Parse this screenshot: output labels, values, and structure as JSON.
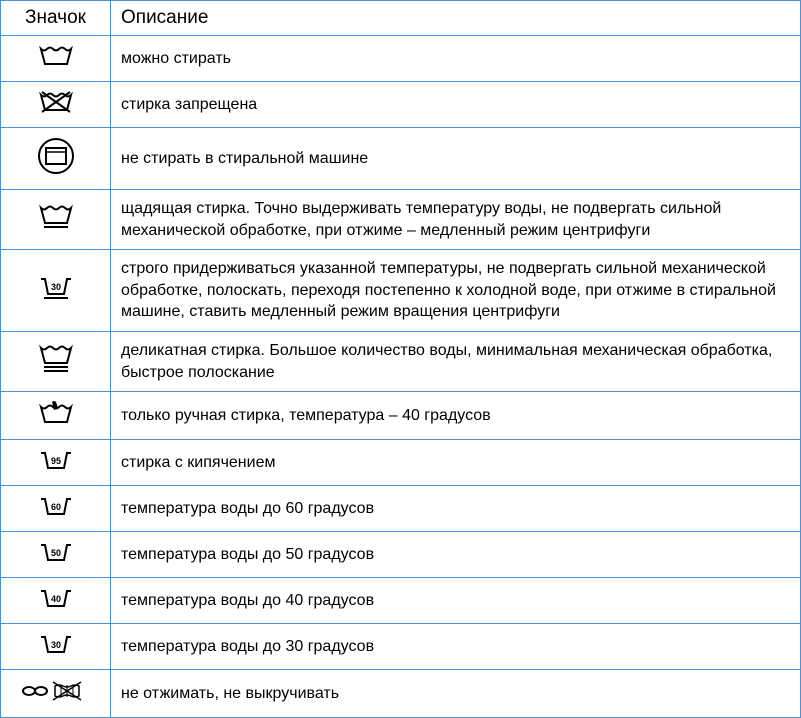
{
  "headers": {
    "icon": "Значок",
    "description": "Описание"
  },
  "rows": [
    {
      "icon": "wash",
      "description": "можно стирать"
    },
    {
      "icon": "nowash",
      "description": "стирка запрещена"
    },
    {
      "icon": "nomachine",
      "description": "не стирать в стиральной машине"
    },
    {
      "icon": "gentle",
      "description": "щадящая стирка. Точно выдерживать температуру воды, не подвергать сильной механической обработке, при отжиме – медленный режим центрифуги"
    },
    {
      "icon": "wash30bar",
      "description": "строго придерживаться указанной температуры, не подвергать сильной механической обработке, полоскать, переходя постепенно к холодной воде, при отжиме в стиральной машине, ставить медленный режим вращения центрифуги"
    },
    {
      "icon": "delicate",
      "description": "деликатная стирка. Большое количество воды, минимальная механическая обработка, быстрое полоскание"
    },
    {
      "icon": "handwash",
      "description": "только ручная стирка, температура – 40 градусов"
    },
    {
      "icon": "wash95",
      "description": "стирка с кипячением"
    },
    {
      "icon": "wash60",
      "description": "температура воды до 60 градусов"
    },
    {
      "icon": "wash50",
      "description": "температура воды до 50 градусов"
    },
    {
      "icon": "wash40",
      "description": "температура воды до 40 градусов"
    },
    {
      "icon": "wash30",
      "description": "температура воды до 30 градусов"
    },
    {
      "icon": "nowring",
      "description": "не отжимать, не выкручивать"
    }
  ]
}
